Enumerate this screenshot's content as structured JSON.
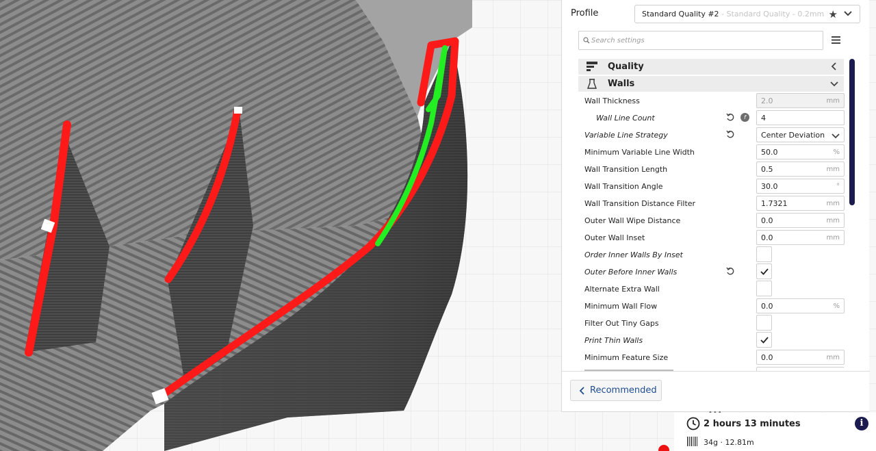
{
  "profile": {
    "label": "Profile",
    "name": "Standard Quality #2",
    "subtitle": " - Standard Quality - 0.2mm"
  },
  "search": {
    "placeholder": "Search settings"
  },
  "categories": [
    {
      "label": "Quality",
      "icon": "quality-icon",
      "state": "collapsed"
    },
    {
      "label": "Walls",
      "icon": "walls-icon",
      "state": "expanded"
    }
  ],
  "settings": [
    {
      "label": "Wall Thickness",
      "value": "2.0",
      "unit": "mm"
    },
    {
      "label": "Wall Line Count",
      "value": "4"
    },
    {
      "label": "Variable Line Strategy",
      "value": "Center Deviation"
    },
    {
      "label": "Minimum Variable Line Width",
      "value": "50.0",
      "unit": "%"
    },
    {
      "label": "Wall Transition Length",
      "value": "0.5",
      "unit": "mm"
    },
    {
      "label": "Wall Transition Angle",
      "value": "30.0",
      "unit": "°"
    },
    {
      "label": "Wall Transition Distance Filter",
      "value": "1.7321",
      "unit": "mm"
    },
    {
      "label": "Outer Wall Wipe Distance",
      "value": "0.0",
      "unit": "mm"
    },
    {
      "label": "Outer Wall Inset",
      "value": "0.0",
      "unit": "mm"
    },
    {
      "label": "Order Inner Walls By Inset",
      "checked": false
    },
    {
      "label": "Outer Before Inner Walls",
      "checked": true
    },
    {
      "label": "Alternate Extra Wall",
      "checked": false
    },
    {
      "label": "Minimum Wall Flow",
      "value": "0.0",
      "unit": "%"
    },
    {
      "label": "Filter Out Tiny Gaps",
      "checked": false
    },
    {
      "label": "Print Thin Walls",
      "checked": true
    },
    {
      "label": "Minimum Feature Size",
      "value": "0.0",
      "unit": "mm"
    }
  ],
  "recommended_button": "Recommended",
  "print_info": {
    "time": "2 hours 13 minutes",
    "material": "34g · 12.81m"
  },
  "colors": {
    "accent": "#1b1b4f",
    "wall_outer": "#ff1a1a",
    "wall_inner": "#22ee22",
    "link": "#1f4d8f"
  }
}
